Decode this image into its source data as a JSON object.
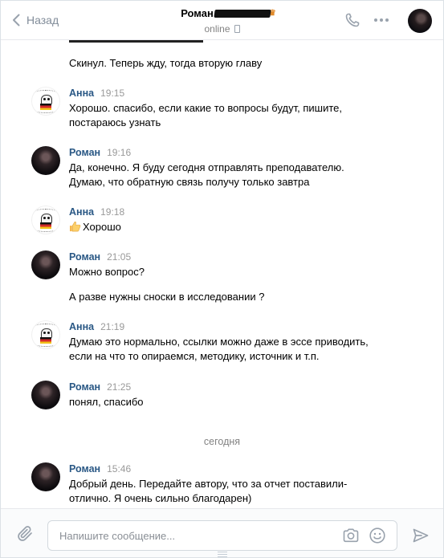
{
  "header": {
    "back_label": "Назад",
    "chat_name": "Роман",
    "status": "online"
  },
  "composer": {
    "placeholder": "Напишите сообщение..."
  },
  "date_separator": "сегодня",
  "messages": [
    {
      "type": "plain",
      "text": "Скинул. Теперь жду, тогда вторую главу"
    },
    {
      "author": "Анна",
      "time": "19:15",
      "lines": [
        "Хорошо. спасибо, если какие то вопросы будут, пишите,",
        "постараюсь узнать"
      ]
    },
    {
      "author": "Роман",
      "time": "19:16",
      "lines": [
        "Да, конечно. Я буду сегодня отправлять преподавателю.",
        "Думаю, что обратную связь получу только завтра"
      ]
    },
    {
      "author": "Анна",
      "time": "19:18",
      "lines": [
        "Хорошо"
      ],
      "emoji": "thumbs-up"
    },
    {
      "author": "Роман",
      "time": "21:05",
      "lines": [
        "Можно вопрос?"
      ]
    },
    {
      "type": "plain",
      "text": "А разве нужны сноски в исследовании ?"
    },
    {
      "author": "Анна",
      "time": "21:19",
      "lines": [
        "Думаю это нормально, ссылки можно даже в эссе приводить,",
        "если на что то опираемся, методику, источник и т.п."
      ]
    },
    {
      "author": "Роман",
      "time": "21:25",
      "lines": [
        "понял, спасибо"
      ]
    },
    {
      "author": "Роман",
      "time": "15:46",
      "lines": [
        "Добрый день. Передайте автору, что за отчет поставили-",
        "отлично. Я очень сильно благодарен)"
      ]
    }
  ],
  "colors": {
    "author_name": "#2a5885",
    "time": "#999999",
    "icon": "#99a2ad"
  }
}
